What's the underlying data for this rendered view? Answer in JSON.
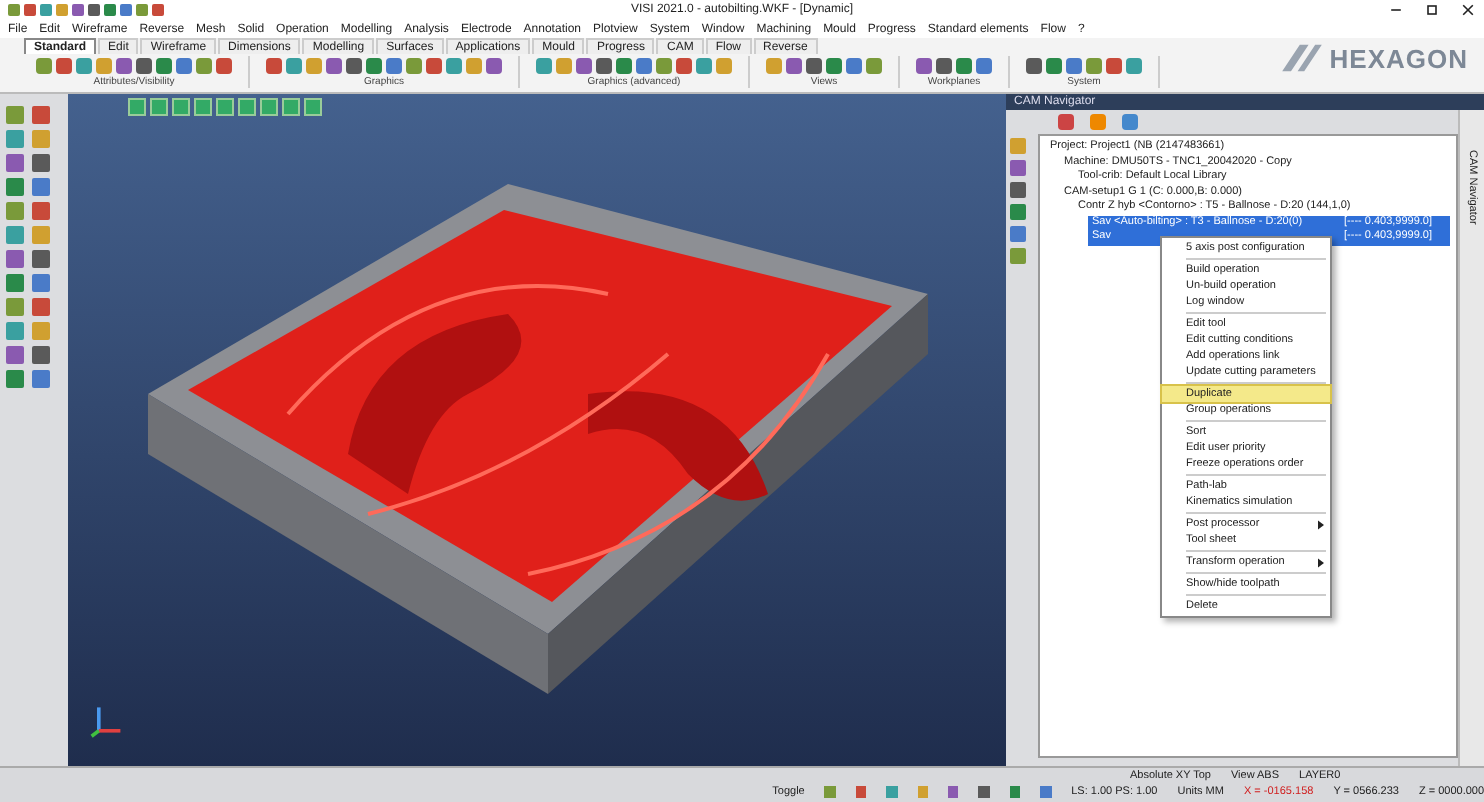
{
  "window": {
    "title": "VISI 2021.0 - autobilting.WKF - [Dynamic]",
    "logo": "HEXAGON"
  },
  "menu": [
    "File",
    "Edit",
    "Wireframe",
    "Reverse",
    "Mesh",
    "Solid",
    "Operation",
    "Modelling",
    "Analysis",
    "Electrode",
    "Annotation",
    "Plotview",
    "System",
    "Window",
    "Machining",
    "Mould",
    "Progress",
    "Standard elements",
    "Flow",
    "?"
  ],
  "ribbon": {
    "tabs": [
      {
        "label": "Standard",
        "selected": true
      },
      {
        "label": "Edit",
        "selected": false
      },
      {
        "label": "Wireframe",
        "selected": false
      },
      {
        "label": "Dimensions",
        "selected": false
      },
      {
        "label": "Modelling",
        "selected": false
      },
      {
        "label": "Surfaces",
        "selected": false
      },
      {
        "label": "Applications",
        "selected": false
      },
      {
        "label": "Mould",
        "selected": false
      },
      {
        "label": "Progress",
        "selected": false
      },
      {
        "label": "CAM",
        "selected": false
      },
      {
        "label": "Flow",
        "selected": false
      },
      {
        "label": "Reverse",
        "selected": false
      }
    ],
    "groups": [
      "Attributes/Visibility",
      "Graphics",
      "Graphics (advanced)",
      "Views",
      "Workplanes",
      "System"
    ]
  },
  "cam_navigator": {
    "title": "CAM Navigator",
    "side_tab": "CAM Navigator",
    "tree": [
      {
        "label": "Project: Project1 (NB (2147483661)",
        "selected": false,
        "children": [
          {
            "label": "Machine: DMU50TS - TNC1_20042020 - Copy",
            "selected": false,
            "children": [
              {
                "label": "Tool-crib: Default Local Library",
                "selected": false
              }
            ]
          },
          {
            "label": "CAM-setup1 G 1 (C: 0.000,B: 0.000)",
            "selected": false,
            "children": [
              {
                "label": "Contr Z hyb <Contorno> : T5 - Ballnose - D:20 (144,1,0)",
                "selected": false,
                "children": [
                  {
                    "label": "Sav <Auto-bilting> : T3 - Ballnose - D:20(0)",
                    "range": "[---- 0.403,9999.0]",
                    "selected": true
                  },
                  {
                    "label": "Sav",
                    "range": "[---- 0.403,9999.0]",
                    "selected": true
                  }
                ]
              }
            ]
          }
        ]
      }
    ]
  },
  "context_menu": {
    "groups": [
      [
        {
          "label": "5 axis post configuration",
          "selected": false,
          "submenu": false
        }
      ],
      [
        {
          "label": "Build operation",
          "selected": false,
          "submenu": false
        },
        {
          "label": "Un-build operation",
          "selected": false,
          "submenu": false
        },
        {
          "label": "Log window",
          "selected": false,
          "submenu": false
        }
      ],
      [
        {
          "label": "Edit tool",
          "selected": false,
          "submenu": false
        },
        {
          "label": "Edit cutting conditions",
          "selected": false,
          "submenu": false
        },
        {
          "label": "Add operations link",
          "selected": false,
          "submenu": false
        },
        {
          "label": "Update cutting parameters",
          "selected": false,
          "submenu": false
        }
      ],
      [
        {
          "label": "Duplicate",
          "selected": true,
          "submenu": false
        },
        {
          "label": "Group operations",
          "selected": false,
          "submenu": false
        }
      ],
      [
        {
          "label": "Sort",
          "selected": false,
          "submenu": false
        },
        {
          "label": "Edit user priority",
          "selected": false,
          "submenu": false
        },
        {
          "label": "Freeze operations order",
          "selected": false,
          "submenu": false
        }
      ],
      [
        {
          "label": "Path-lab",
          "selected": false,
          "submenu": false
        },
        {
          "label": "Kinematics simulation",
          "selected": false,
          "submenu": false
        }
      ],
      [
        {
          "label": "Post processor",
          "selected": false,
          "submenu": true
        },
        {
          "label": "Tool sheet",
          "selected": false,
          "submenu": false
        }
      ],
      [
        {
          "label": "Transform operation",
          "selected": false,
          "submenu": true
        }
      ],
      [
        {
          "label": "Show/hide toolpath",
          "selected": false,
          "submenu": false
        }
      ],
      [
        {
          "label": "Delete",
          "selected": false,
          "submenu": false
        }
      ]
    ]
  },
  "status_bar": {
    "workplane": "Absolute XY Top",
    "view": "View ABS",
    "layer": "LAYER0",
    "toggle": "Toggle",
    "scale": "LS: 1.00 PS: 1.00",
    "units": "Units MM",
    "x": "X = -0165.158",
    "y": "Y = 0566.233",
    "z": "Z = 0000.000"
  }
}
